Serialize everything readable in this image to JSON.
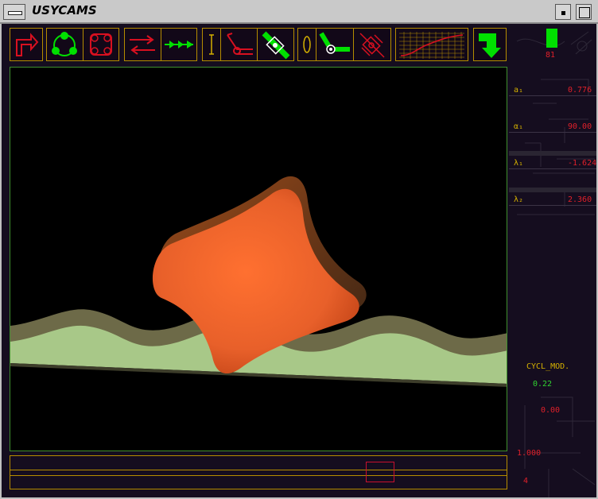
{
  "window": {
    "title": "USYCAMS"
  },
  "toolbar": {
    "buttons": [
      {
        "icon": "exit-arrow-icon"
      },
      {
        "icon": "rotate-cam-icon"
      },
      {
        "icon": "cam-profile-icon"
      },
      {
        "icon": "forward-backward-icon"
      },
      {
        "icon": "step-forward-icon"
      },
      {
        "icon": "translating-follower-icon"
      },
      {
        "icon": "rocker-arm-red-icon"
      },
      {
        "icon": "roller-follower-green-icon"
      },
      {
        "icon": "oval-follower-icon"
      },
      {
        "icon": "oscillating-roller-green-icon"
      },
      {
        "icon": "roller-follower-red-icon"
      },
      {
        "icon": "motion-graph-icon"
      },
      {
        "icon": "down-arrow-icon"
      }
    ]
  },
  "parameters": {
    "counter": "81",
    "items": [
      {
        "symbol": "a₁",
        "value": "0.776"
      },
      {
        "symbol": "α₁",
        "value": "90.00"
      },
      {
        "symbol": "λ₁",
        "value": "-1.624"
      },
      {
        "symbol": "λ₂",
        "value": "2.360"
      }
    ],
    "cycle_mode_label": "CYCL_MOD.",
    "cycle_value": "0.22",
    "cycle_offset": "0.00",
    "scale_value": "1.000",
    "step_value": "4"
  },
  "colors": {
    "accent_yellow": "#b58c00",
    "icon_green": "#00e000",
    "icon_red": "#d81020",
    "cam_orange": "#e8602a",
    "track_light": "#a8c888",
    "track_dark": "#6d6a48"
  },
  "scroll": {
    "position": 0.76
  }
}
